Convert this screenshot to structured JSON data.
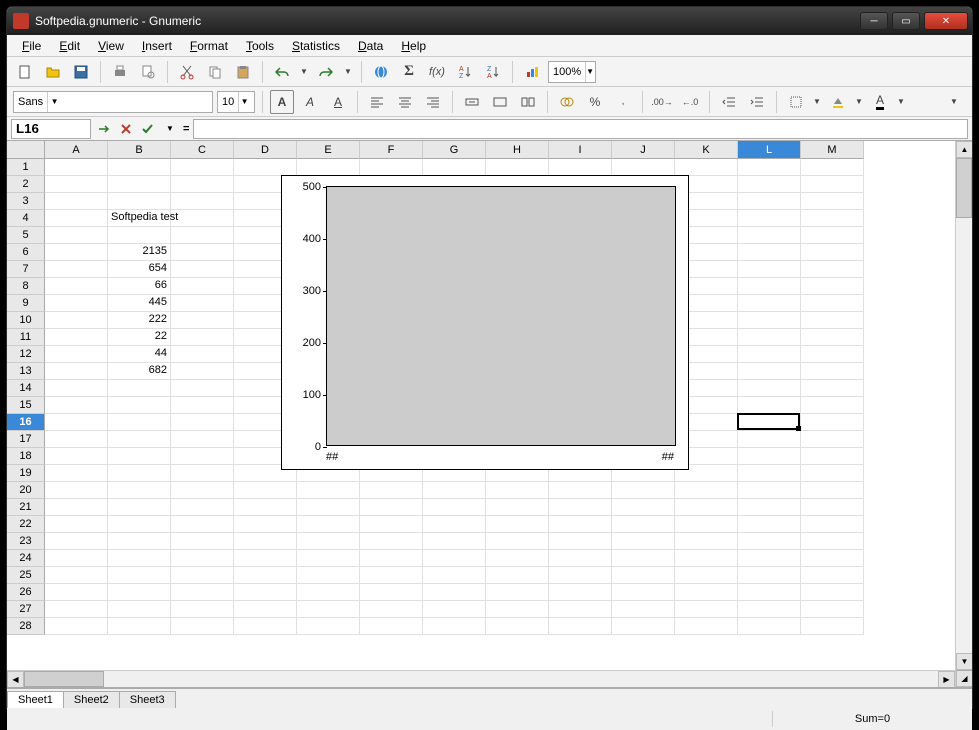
{
  "window": {
    "title": "Softpedia.gnumeric - Gnumeric"
  },
  "menu": [
    "File",
    "Edit",
    "View",
    "Insert",
    "Format",
    "Tools",
    "Statistics",
    "Data",
    "Help"
  ],
  "toolbar": {
    "zoom": "100%"
  },
  "format": {
    "font": "Sans",
    "size": "10"
  },
  "refbar": {
    "cell": "L16",
    "formula": ""
  },
  "columns": [
    "A",
    "B",
    "C",
    "D",
    "E",
    "F",
    "G",
    "H",
    "I",
    "J",
    "K",
    "L",
    "M"
  ],
  "selected_col": "L",
  "rows": 28,
  "selected_row": 16,
  "cell_text": {
    "B4": "Softpedia test"
  },
  "cell_num": {
    "B6": "2135",
    "B7": "654",
    "B8": "66",
    "B9": "445",
    "B10": "222",
    "B11": "22",
    "B12": "44",
    "B13": "682"
  },
  "cursor": {
    "col": 11,
    "row": 16
  },
  "chart_data": {
    "type": "bar",
    "ylim": [
      0,
      500
    ],
    "yticks": [
      0,
      100,
      200,
      300,
      400,
      500
    ],
    "xlabels": [
      "##",
      "##"
    ],
    "categories": [],
    "values": [],
    "title": "",
    "xlabel": "",
    "ylabel": ""
  },
  "sheets": [
    "Sheet1",
    "Sheet2",
    "Sheet3"
  ],
  "active_sheet": 0,
  "status": {
    "sum": "Sum=0"
  }
}
